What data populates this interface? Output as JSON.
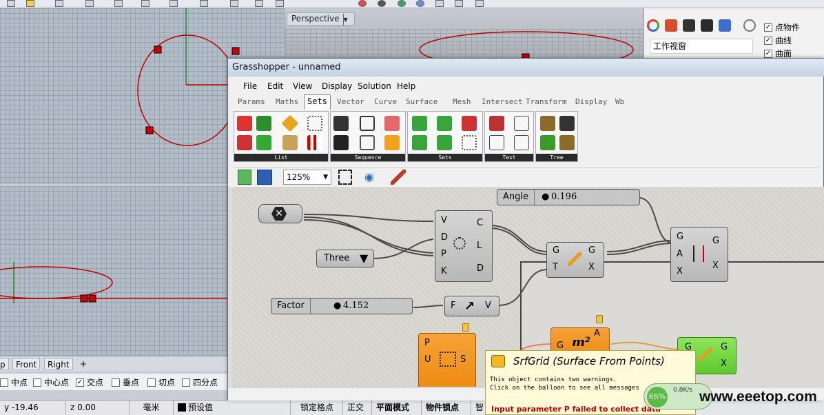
{
  "perspective": {
    "label": "Perspective"
  },
  "right_panel": {
    "title": "工作视窗",
    "checks": [
      {
        "label": "点物件",
        "checked": true
      },
      {
        "label": "曲线",
        "checked": true
      },
      {
        "label": "曲面",
        "checked": true
      }
    ]
  },
  "viewport_tabs": [
    "p",
    "Front",
    "Right",
    "+"
  ],
  "snaps": [
    {
      "label": "中点",
      "checked": false
    },
    {
      "label": "中心点",
      "checked": false
    },
    {
      "label": "交点",
      "checked": true
    },
    {
      "label": "垂点",
      "checked": false
    },
    {
      "label": "切点",
      "checked": false
    },
    {
      "label": "四分点",
      "checked": false
    }
  ],
  "status": {
    "y": "y -19.46",
    "z": "z 0.00",
    "unit": "毫米",
    "layer": "预设值",
    "grid_snap": "锁定格点",
    "ortho": "正交",
    "planar": "平面模式",
    "osnap": "物件锁点",
    "smart": "智"
  },
  "gh": {
    "title": "Grasshopper - unnamed",
    "menu": [
      "File",
      "Edit",
      "View",
      "Display",
      "Solution",
      "Help"
    ],
    "tabs": [
      "Params",
      "Maths",
      "Sets",
      "Vector",
      "Curve",
      "Surface",
      "Mesh",
      "Intersect",
      "Transform",
      "Display",
      "Wb"
    ],
    "active_tab": "Sets",
    "ribbon_groups": [
      "List",
      "Sequence",
      "Sets",
      "Text",
      "Tree"
    ],
    "zoom": "125%",
    "canvas": {
      "angle_slider": {
        "name": "Angle",
        "value": "0.196"
      },
      "factor_slider": {
        "name": "Factor",
        "value": "4.152"
      },
      "value_list": {
        "value": "Three"
      },
      "circle_node": {
        "inputs": [
          "V",
          "D",
          "P",
          "K"
        ],
        "outputs": [
          "C",
          "L",
          "D"
        ]
      },
      "move_node": {
        "inputs": [
          "G",
          "T"
        ],
        "outputs": [
          "G",
          "X"
        ]
      },
      "rotate_node": {
        "inputs": [
          "G",
          "A",
          "X"
        ],
        "outputs": [
          "G",
          "X"
        ]
      },
      "amp_node": {
        "inputs": [
          "F"
        ],
        "outputs": [
          "V"
        ]
      },
      "srfgrid_node": {
        "inputs": [
          "P",
          "U"
        ],
        "outputs": [
          "S"
        ]
      },
      "area_node": {
        "inputs": [
          "G"
        ],
        "outputs": [
          "A"
        ]
      },
      "green_node": {
        "inputs": [
          "G"
        ],
        "outputs": [
          "G",
          "X"
        ]
      }
    },
    "tooltip": {
      "title": "SrfGrid (Surface From Points)",
      "body1": "This object contains two warnings.",
      "body2": "Click on the balloon to see all messages",
      "error": "Input parameter P failed to collect data"
    }
  },
  "netmon": {
    "percent": "66%",
    "speed": "0.8K/s"
  },
  "watermark": "www.eeetop.com"
}
